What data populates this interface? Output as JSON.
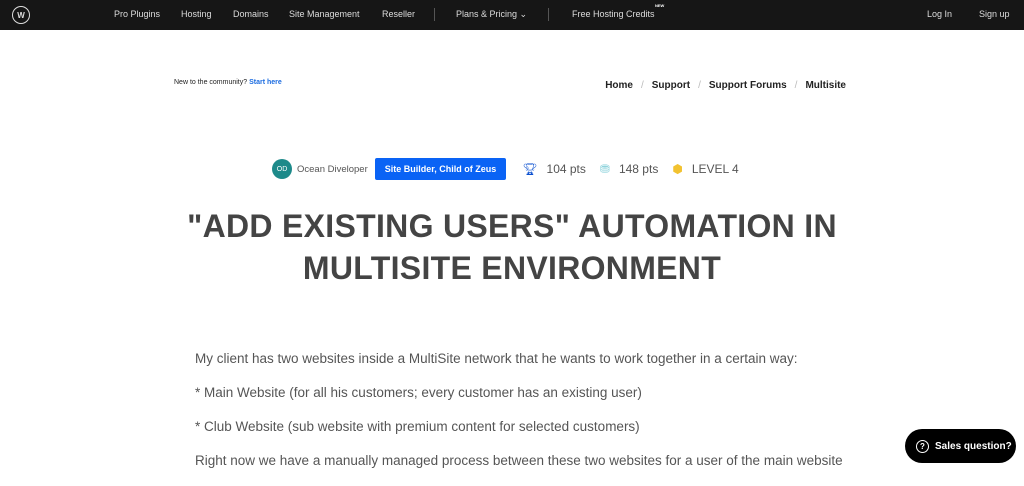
{
  "nav": {
    "logo": "W",
    "items": [
      "Pro Plugins",
      "Hosting",
      "Domains",
      "Site Management",
      "Reseller"
    ],
    "plans": "Plans & Pricing",
    "credits": "Free Hosting Credits",
    "new_badge": "NEW",
    "login": "Log In",
    "signup": "Sign up"
  },
  "community": {
    "text": "New to the community?",
    "link": "Start here"
  },
  "breadcrumb": [
    "Home",
    "Support",
    "Support Forums",
    "Multisite"
  ],
  "author": {
    "avatar": "OD",
    "name": "Ocean Diveloper",
    "badge": "Site Builder, Child of Zeus",
    "points1": "104 pts",
    "points2": "148 pts",
    "level": "LEVEL 4"
  },
  "title_line1": "\"ADD EXISTING USERS\" AUTOMATION IN",
  "title_line2": "MULTISITE ENVIRONMENT",
  "paragraphs": [
    "My client has two websites inside a MultiSite network that he wants to work together in a certain way:",
    "* Main Website (for all his customers; every customer has an existing user)",
    "* Club Website (sub website with premium content for selected customers)",
    "Right now we have a manually managed process between these two websites for a user of the main website"
  ],
  "sales": "Sales question?"
}
